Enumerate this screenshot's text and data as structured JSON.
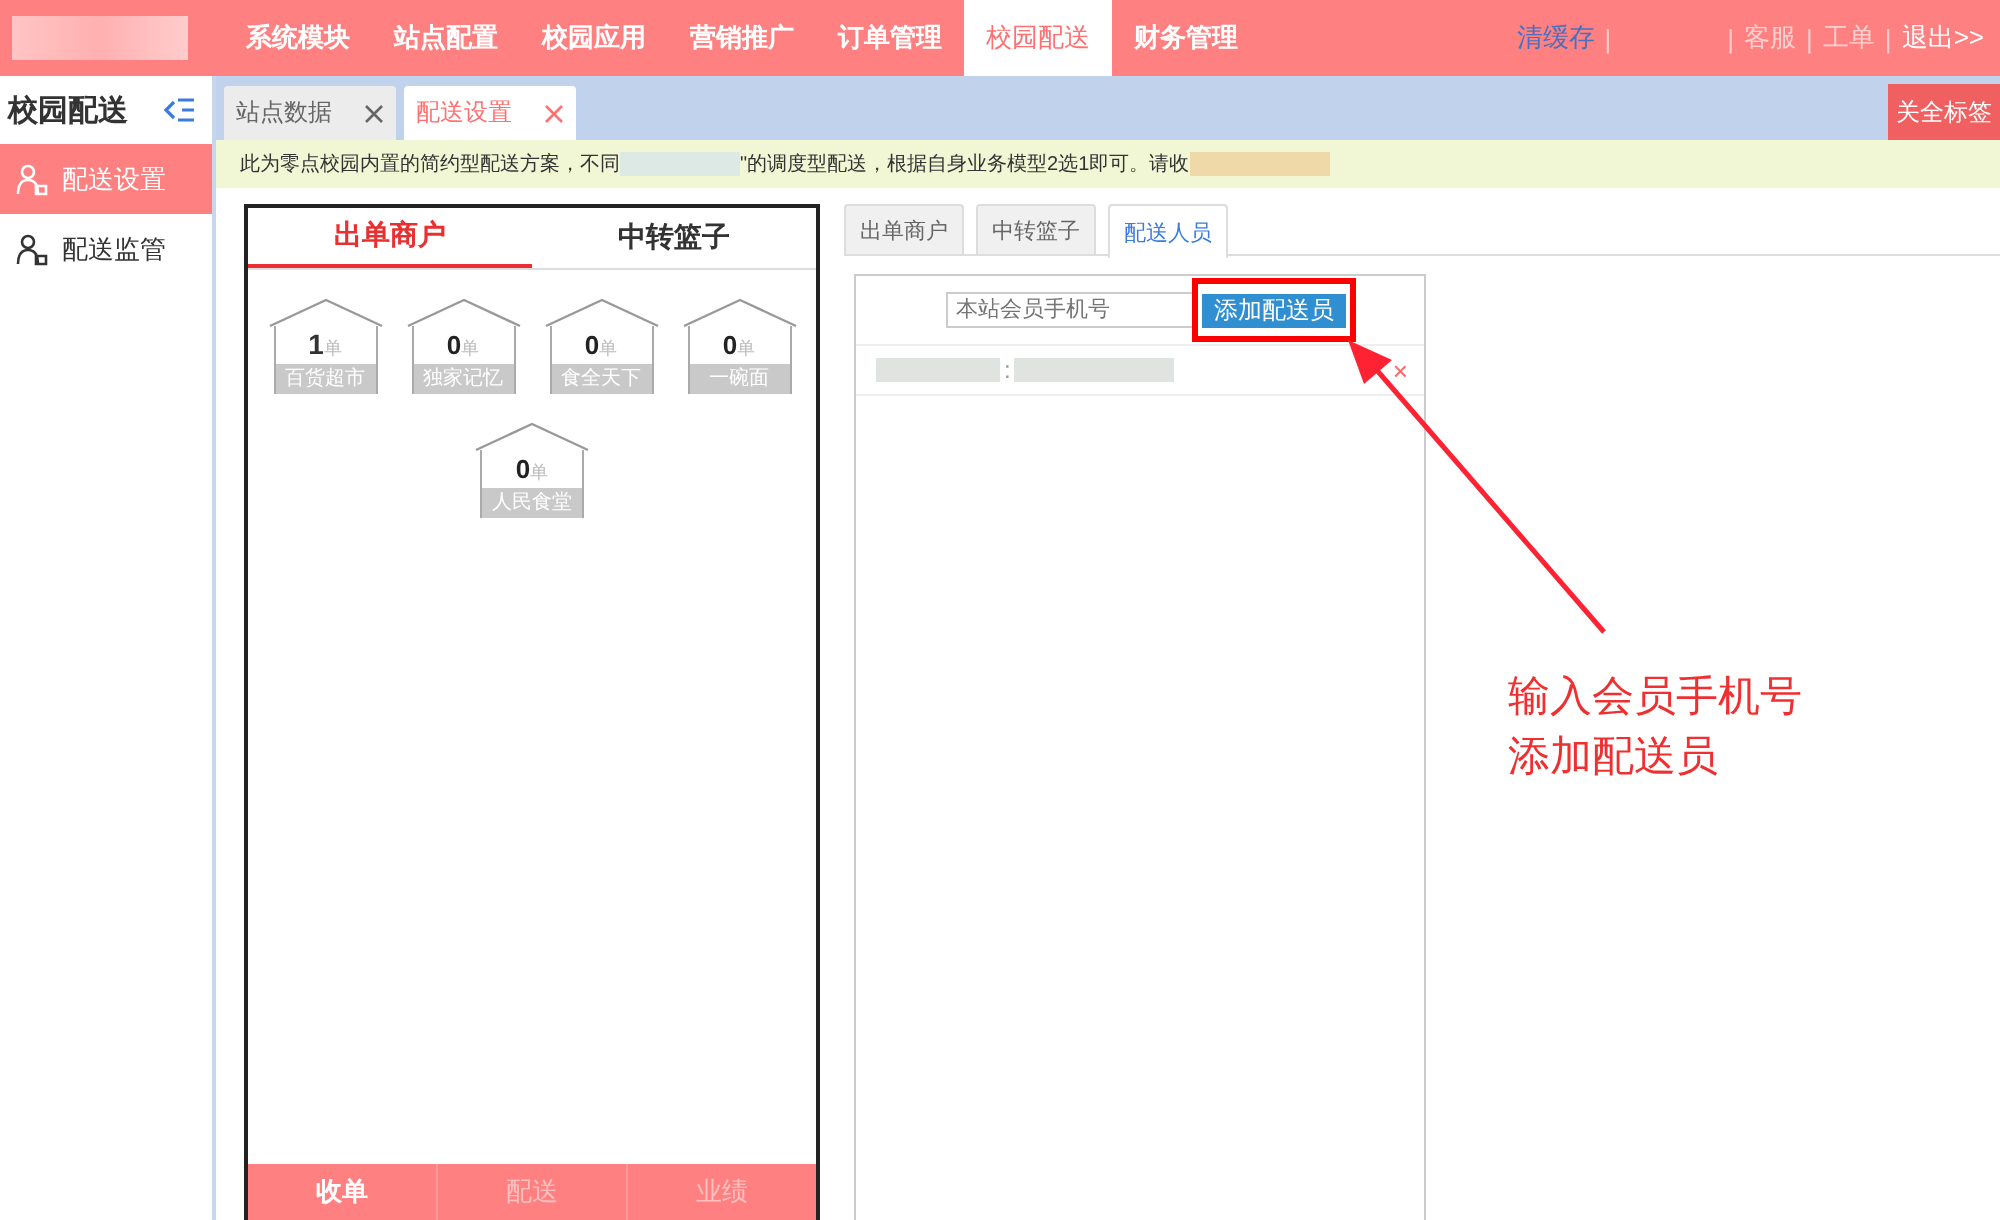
{
  "top_nav": {
    "items": [
      {
        "label": "系统模块",
        "selected": false
      },
      {
        "label": "站点配置",
        "selected": false
      },
      {
        "label": "校园应用",
        "selected": false
      },
      {
        "label": "营销推广",
        "selected": false
      },
      {
        "label": "订单管理",
        "selected": false
      },
      {
        "label": "校园配送",
        "selected": true
      },
      {
        "label": "财务管理",
        "selected": false
      }
    ],
    "separator": "|",
    "links": [
      {
        "label": "清缓存",
        "kind": "primary"
      },
      {
        "label": "客服",
        "kind": "muted"
      },
      {
        "label": "工单",
        "kind": "muted"
      },
      {
        "label": "退出>>",
        "kind": "plain"
      }
    ]
  },
  "sidebar": {
    "title": "校园配送",
    "items": [
      {
        "label": "配送设置",
        "selected": true
      },
      {
        "label": "配送监管",
        "selected": false
      }
    ]
  },
  "page_tabs": [
    {
      "label": "站点数据",
      "selected": false
    },
    {
      "label": "配送设置",
      "selected": true
    }
  ],
  "close_all": "关全标签",
  "notice": {
    "before": "此为零点校园内置的简约型配送方案，不同",
    "after": "\"的调度型配送，根据自身业务模型2选1即可。请收"
  },
  "left_panel": {
    "tabs": [
      {
        "label": "出单商户",
        "selected": true
      },
      {
        "label": "中转篮子",
        "selected": false
      }
    ],
    "shops": [
      {
        "count": "1",
        "unit": "单",
        "name": "百货超市",
        "active": true
      },
      {
        "count": "0",
        "unit": "单",
        "name": "独家记忆",
        "active": false
      },
      {
        "count": "0",
        "unit": "单",
        "name": "食全天下",
        "active": false
      },
      {
        "count": "0",
        "unit": "单",
        "name": "一碗面",
        "active": false
      },
      {
        "count": "0",
        "unit": "单",
        "name": "人民食堂",
        "active": false
      }
    ],
    "bottom_tabs": [
      {
        "label": "收单",
        "selected": true
      },
      {
        "label": "配送",
        "selected": false
      },
      {
        "label": "业绩",
        "selected": false
      }
    ]
  },
  "right_panel": {
    "tabs": [
      {
        "label": "出单商户",
        "selected": false
      },
      {
        "label": "中转篮子",
        "selected": false
      },
      {
        "label": "配送人员",
        "selected": true
      }
    ],
    "phone_field": {
      "placeholder": "本站会员手机号"
    },
    "add_button": "添加配送员",
    "staff_rows": [
      {
        "separator": ":",
        "remove": "×"
      }
    ]
  },
  "annotation": {
    "lines": [
      "输入会员手机号",
      "添加配送员"
    ]
  }
}
